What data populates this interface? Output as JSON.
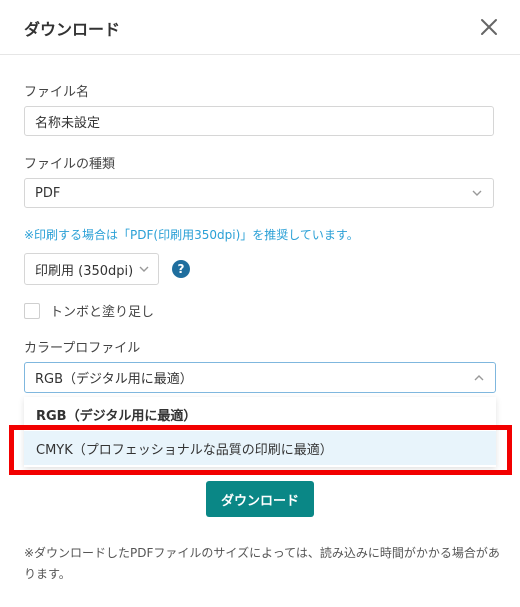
{
  "dialog": {
    "title": "ダウンロード",
    "close_icon": "close-icon"
  },
  "fields": {
    "file_name_label": "ファイル名",
    "file_name_value": "名称未設定",
    "file_type_label": "ファイルの種類",
    "file_type_value": "PDF"
  },
  "note": "※印刷する場合は「PDF(印刷用350dpi)」を推奨しています。",
  "print": {
    "resolution_value": "印刷用 (350dpi)",
    "help_glyph": "?"
  },
  "crop_marks": {
    "label": "トンボと塗り足し",
    "checked": false
  },
  "color_profile": {
    "label": "カラープロファイル",
    "selected": "RGB（デジタル用に最適）",
    "options": [
      "RGB（デジタル用に最適）",
      "CMYK（プロフェッショナルな品質の印刷に最適）"
    ],
    "hovered_index": 1
  },
  "actions": {
    "download_label": "ダウンロード"
  },
  "footer_note": "※ダウンロードしたPDFファイルのサイズによっては、読み込みに時間がかかる場合があります。",
  "colors": {
    "accent_teal": "#0a8786",
    "note_blue": "#2aa0d6",
    "highlight_red": "#f20000",
    "hover_bg": "#e8f4fb"
  }
}
